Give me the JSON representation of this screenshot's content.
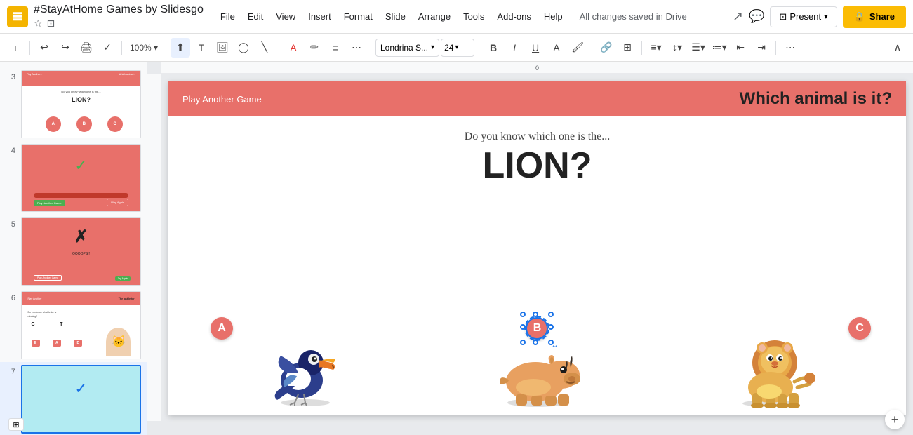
{
  "app": {
    "title": "#StayAtHome Games by Slidesgo",
    "icon_color": "#f4b400"
  },
  "topbar": {
    "menu_items": [
      "File",
      "Edit",
      "View",
      "Insert",
      "Format",
      "Slide",
      "Arrange",
      "Tools",
      "Add-ons",
      "Help"
    ],
    "saved_text": "All changes saved in Drive",
    "present_label": "Present",
    "share_label": "Share"
  },
  "toolbar": {
    "font_name": "Londrina S...",
    "font_size": "24",
    "bold": "B",
    "italic": "I",
    "underline": "U"
  },
  "slides": [
    {
      "num": "3",
      "active": false
    },
    {
      "num": "4",
      "active": false
    },
    {
      "num": "5",
      "active": false
    },
    {
      "num": "6",
      "active": false
    },
    {
      "num": "7",
      "active": true
    }
  ],
  "slide": {
    "header": {
      "left": "Play Another Game",
      "right": "Which animal is it?"
    },
    "subtitle": "Do you know which one is the...",
    "main_title": "LION?",
    "animals": [
      {
        "label": "A",
        "selected": false
      },
      {
        "label": "B",
        "selected": true
      },
      {
        "label": "C",
        "selected": false
      }
    ]
  },
  "bottom": {
    "grid_label": "▦",
    "zoom_add": "+"
  }
}
